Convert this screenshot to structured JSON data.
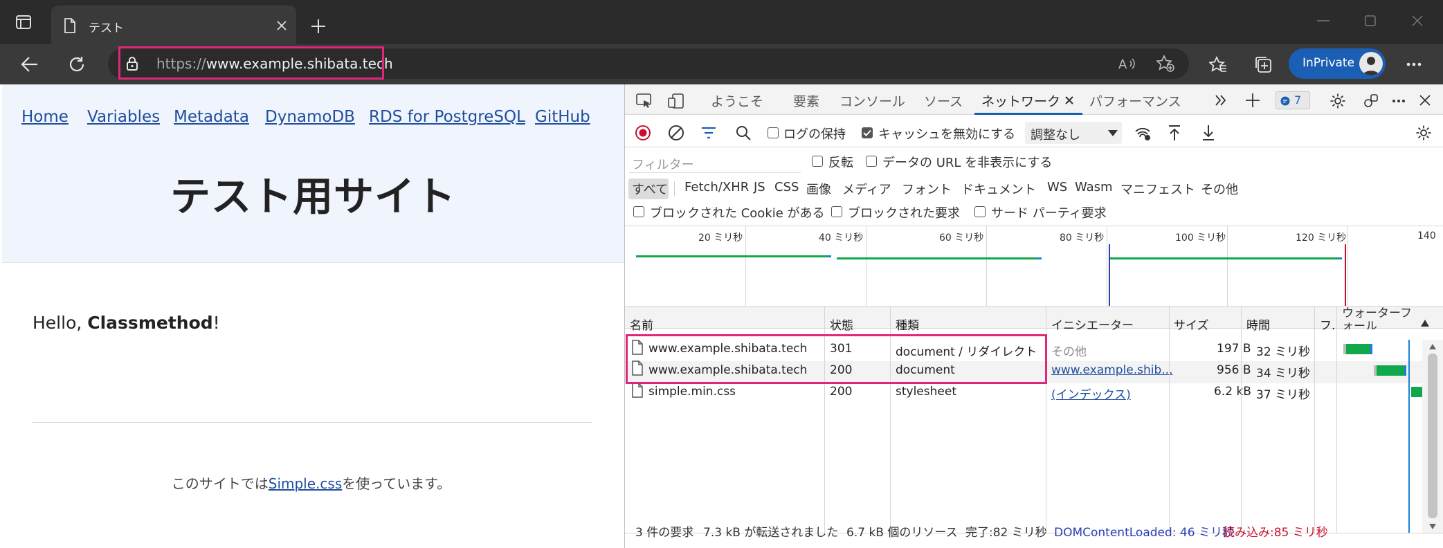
{
  "browser": {
    "tab_title": "テスト",
    "new_tab": "+",
    "url_prefix": "https://",
    "url_host": "www.example.shibata.tech",
    "inprivate_label": "InPrivate"
  },
  "site": {
    "nav": [
      "Home",
      "Variables",
      "Metadata",
      "DynamoDB",
      "RDS for PostgreSQL",
      "GitHub"
    ],
    "title": "テスト用サイト",
    "greeting_prefix": "Hello, ",
    "greeting_bold": "Classmethod",
    "greeting_suffix": "!",
    "footer_prefix": "このサイトでは",
    "footer_link": "Simple.css",
    "footer_suffix": "を使っています。"
  },
  "devtools": {
    "tabs": [
      "ようこそ",
      "要素",
      "コンソール",
      "ソース",
      "ネットワーク",
      "パフォーマンス"
    ],
    "active_tab": "ネットワーク",
    "issues_count": "7",
    "preserve_log": "ログの保持",
    "disable_cache": "キャッシュを無効にする",
    "throttling": "調整なし",
    "filter_placeholder": "フィルター",
    "invert": "反転",
    "hide_data_urls": "データの URL を非表示にする",
    "type_filters": [
      "すべて",
      "Fetch/XHR",
      "JS",
      "CSS",
      "画像",
      "メディア",
      "フォント",
      "ドキュメント",
      "WS",
      "Wasm",
      "マニフェスト",
      "その他"
    ],
    "blocked_cookies": "ブロックされた Cookie がある",
    "blocked_requests": "ブロックされた要求",
    "third_party": "サード パーティ要求",
    "timeline_ticks": [
      "20 ミリ秒",
      "40 ミリ秒",
      "60 ミリ秒",
      "80 ミリ秒",
      "100 ミリ秒",
      "120 ミリ秒",
      "140"
    ],
    "columns": [
      "名前",
      "状態",
      "種類",
      "イニシエーター",
      "サイズ",
      "時間",
      "フ.",
      "ウォーターフォール"
    ],
    "rows": [
      {
        "name": "www.example.shibata.tech",
        "status": "301",
        "type": "document / リダイレクト",
        "initiator": "その他",
        "size": "197 B",
        "time": "32 ミリ秒"
      },
      {
        "name": "www.example.shibata.tech",
        "status": "200",
        "type": "document",
        "initiator": "www.example.shib...",
        "size": "956 B",
        "time": "34 ミリ秒"
      },
      {
        "name": "simple.min.css",
        "status": "200",
        "type": "stylesheet",
        "initiator": "(インデックス)",
        "size": "6.2 kB",
        "time": "37 ミリ秒"
      }
    ],
    "summary": {
      "requests": "3 件の要求",
      "transferred": "7.3 kB が転送されました",
      "resources": "6.7 kB 個のリソース",
      "finish": "完了:82 ミリ秒",
      "dcl": "DOMContentLoaded: 46 ミリ秒",
      "load": "読み込み:85 ミリ秒"
    }
  },
  "colors": {
    "highlight": "#e0287a",
    "link": "#1f4e9e",
    "waterfall_green": "#0fa84a",
    "dcl_blue": "#2a3fb8",
    "load_red": "#c8102e",
    "inprivate_blue": "#1a5fb4"
  }
}
